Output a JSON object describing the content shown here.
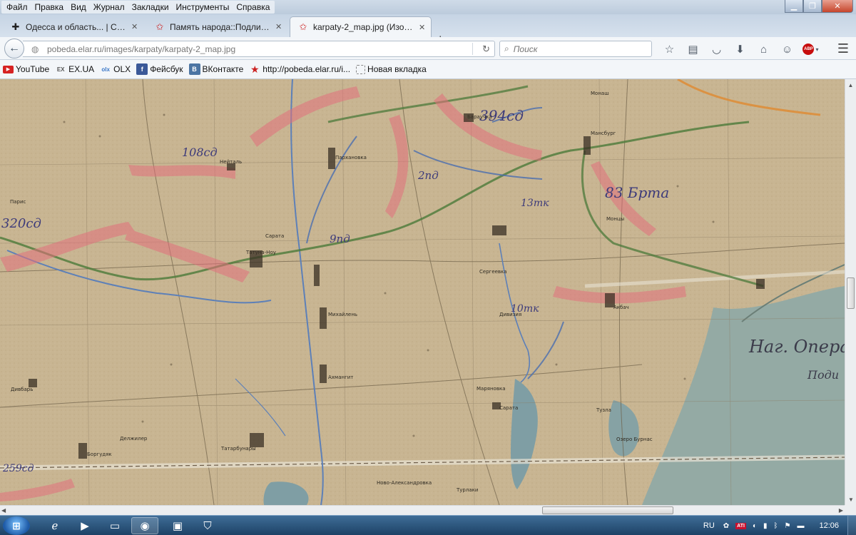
{
  "menu": [
    "Файл",
    "Правка",
    "Вид",
    "Журнал",
    "Закладки",
    "Инструменты",
    "Справка"
  ],
  "tabs": [
    {
      "title": "Одесса и область... | Стра...",
      "icon": "cross-icon"
    },
    {
      "title": "Память народа::Подлинн...",
      "icon": "red-star-icon"
    },
    {
      "title": "karpaty-2_map.jpg (Изобр...",
      "icon": "red-star-icon"
    }
  ],
  "address": {
    "url": "pobeda.elar.ru/images/karpaty/karpaty-2_map.jpg"
  },
  "search": {
    "placeholder": "Поиск"
  },
  "bookmarks": [
    {
      "label": "YouTube",
      "icon_text": "▶"
    },
    {
      "label": "EX.UA",
      "icon_text": "EX"
    },
    {
      "label": "OLX",
      "icon_text": "olx"
    },
    {
      "label": "Фейсбук",
      "icon_text": "f"
    },
    {
      "label": "ВКонтакте",
      "icon_text": "B"
    },
    {
      "label": "http://pobeda.elar.ru/i...",
      "icon_text": "★"
    },
    {
      "label": "Новая вкладка",
      "icon_text": ""
    }
  ],
  "map": {
    "units": [
      "394сд",
      "108сд",
      "2пд",
      "13тк",
      "83 Брта",
      "320сд",
      "9пд",
      "10тк",
      "259сд"
    ],
    "annotations": [
      "Наг. Опера",
      "Поди"
    ],
    "places": [
      "Нейталь",
      "Пархановка",
      "Бараучка",
      "Монаш",
      "Мансбург",
      "Саратa",
      "Татуна-Ноу",
      "Сергеевка",
      "Михайлень",
      "Ахмангит",
      "Дивизия",
      "Акбач",
      "Тузла",
      "Сарата",
      "Татарбунары",
      "Делжилер",
      "Боргудяк",
      "Дивбарь",
      "Ново-Александровка",
      "Турлаки",
      "Озеро Бурнас",
      "Маряновка",
      "Монцы",
      "Парис"
    ]
  },
  "taskbar": {
    "lang": "RU",
    "time": "12:06"
  },
  "colors": {
    "map_paper": "#c7b390",
    "water": "#8da8a8",
    "red_front": "#e2707c",
    "blue_unit": "#4a6eb0",
    "green_line": "#4b7a3a"
  }
}
